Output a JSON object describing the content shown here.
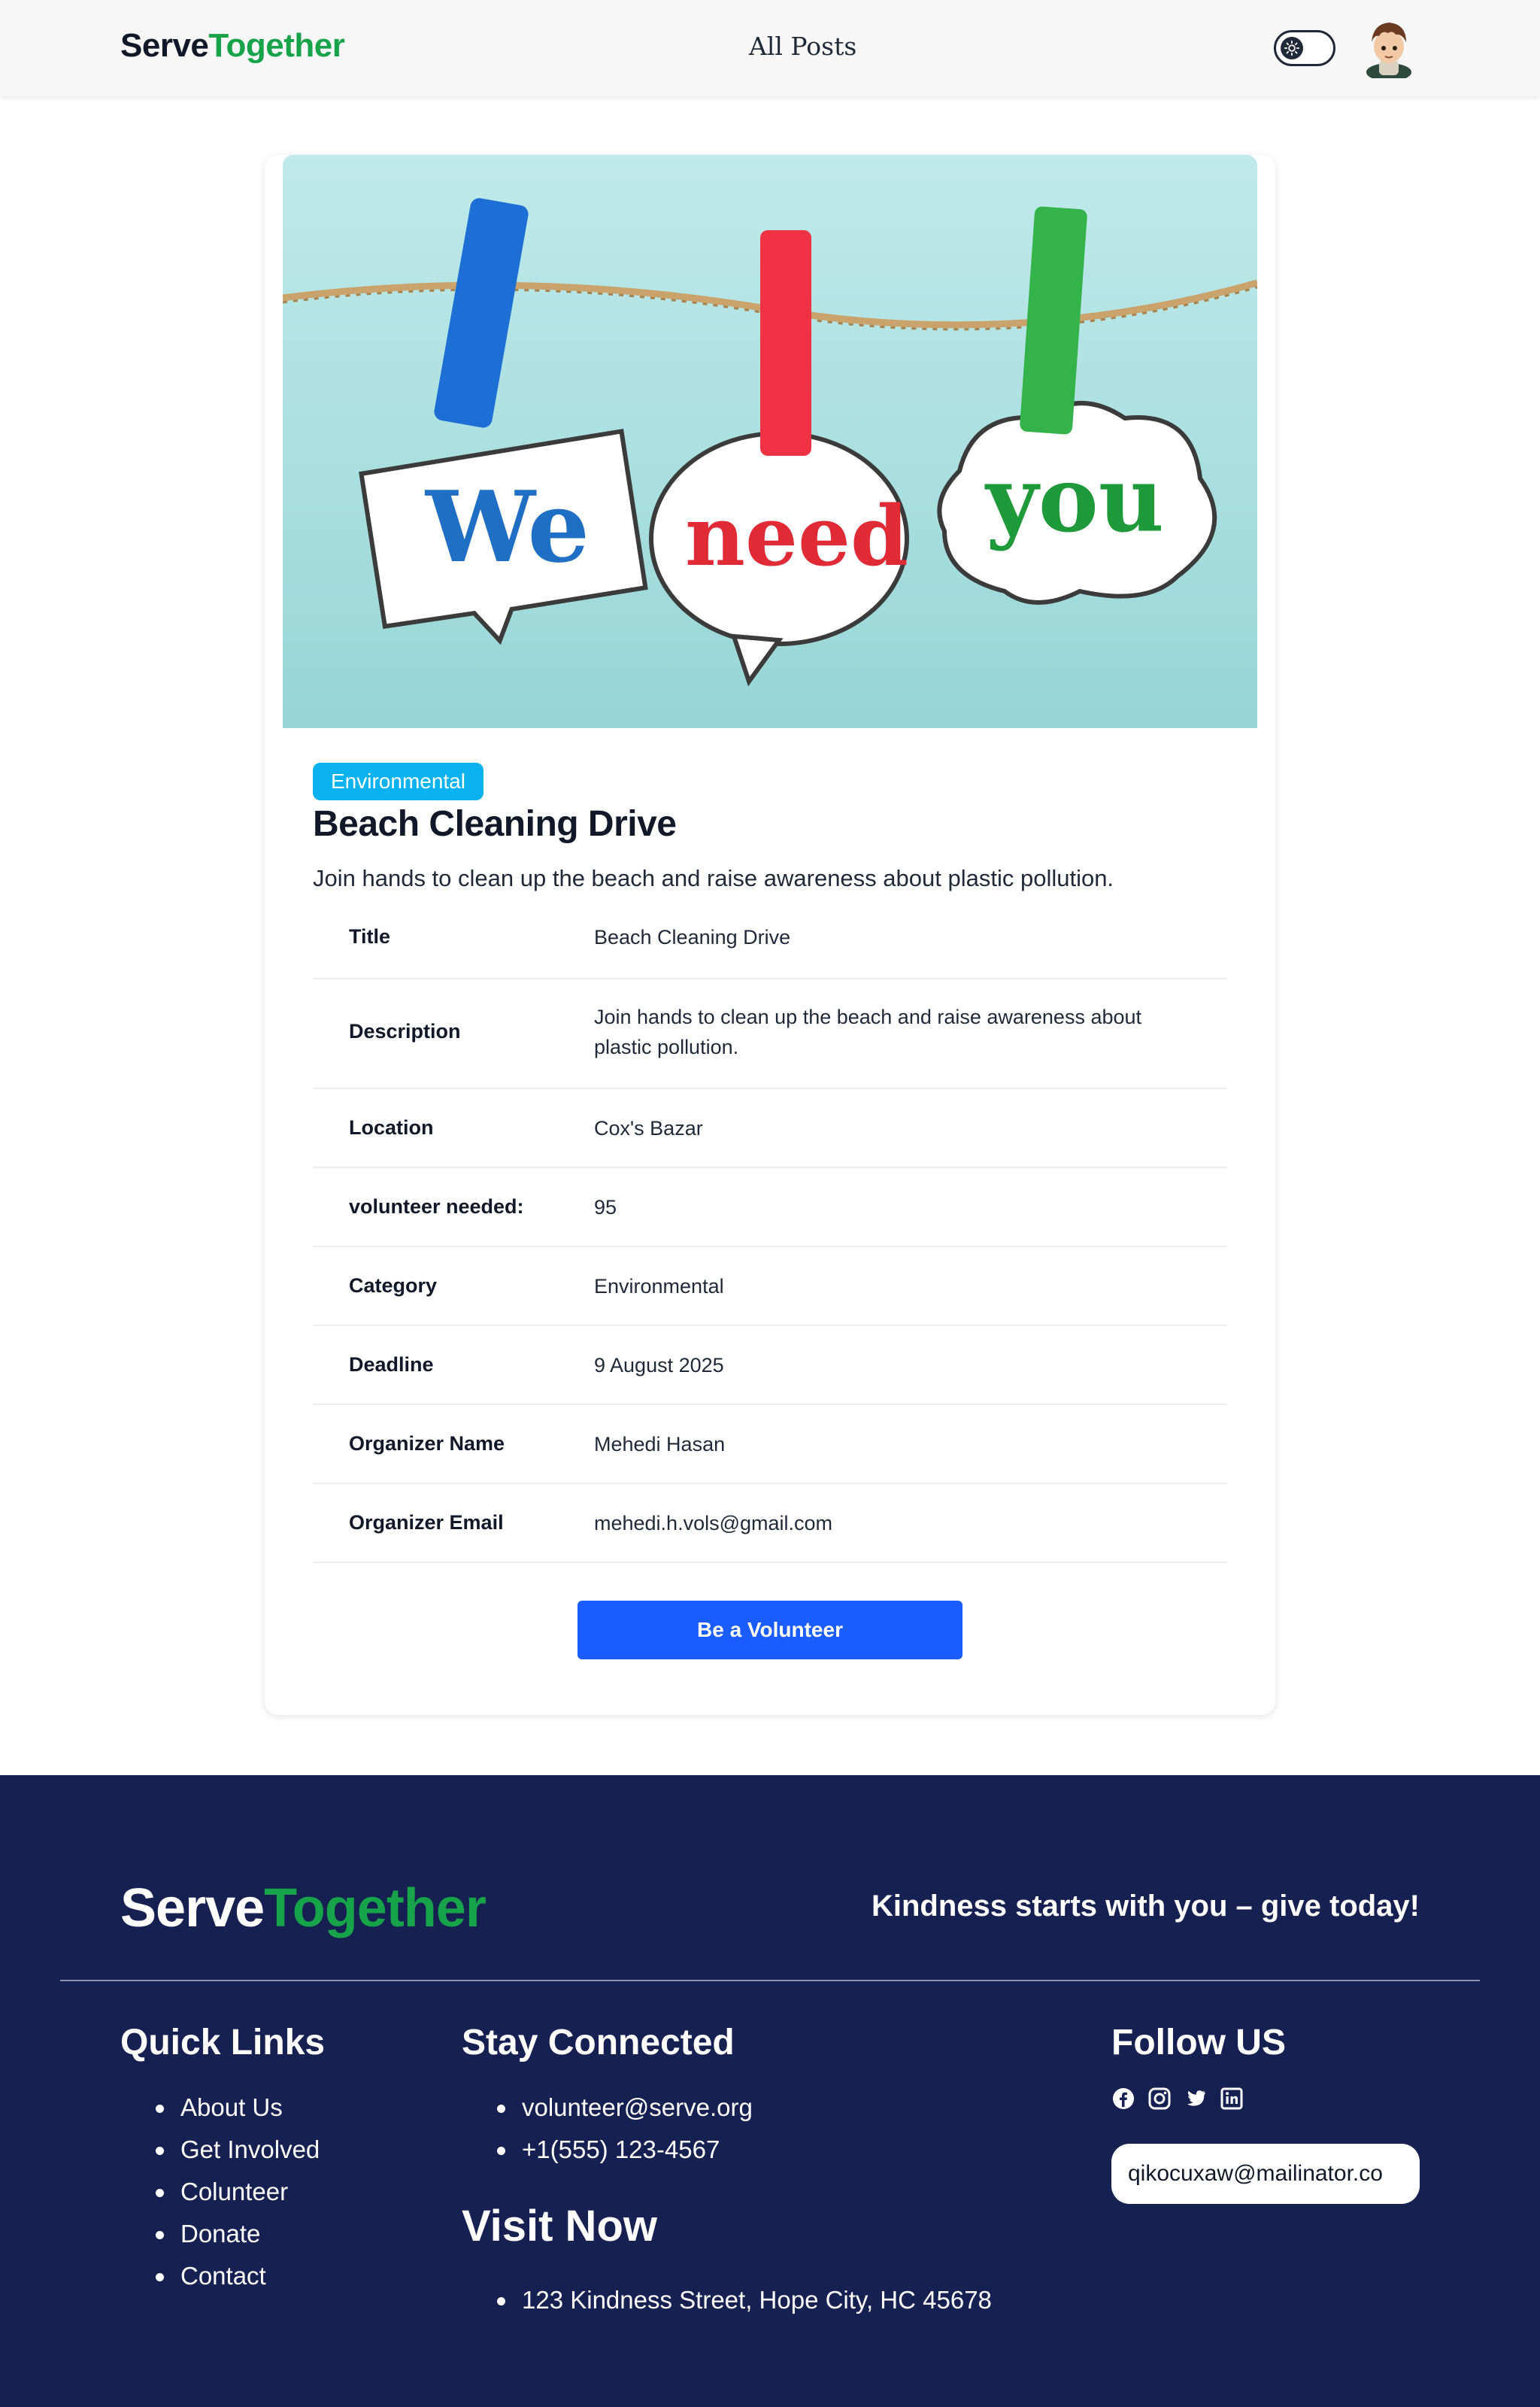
{
  "navbar": {
    "logo_part1": "Serve",
    "logo_part2": "Together",
    "all_posts": "All Posts",
    "theme_toggle_icon": "sun-icon",
    "avatar_icon": "user-avatar"
  },
  "post": {
    "image_text": [
      "We",
      "need",
      "you"
    ],
    "category_badge": "Environmental",
    "title": "Beach Cleaning Drive",
    "description": "Join hands to clean up the beach and raise awareness about plastic pollution.",
    "details": [
      {
        "label": "Title",
        "value": "Beach Cleaning Drive"
      },
      {
        "label": "Description",
        "value": "Join hands to clean up the beach and raise awareness about plastic pollution."
      },
      {
        "label": "Location",
        "value": "Cox's Bazar"
      },
      {
        "label": "volunteer needed:",
        "value": "95"
      },
      {
        "label": "Category",
        "value": "Environmental"
      },
      {
        "label": "Deadline",
        "value": "9 August 2025"
      },
      {
        "label": "Organizer Name",
        "value": "Mehedi Hasan"
      },
      {
        "label": "Organizer Email",
        "value": "mehedi.h.vols@gmail.com"
      }
    ],
    "volunteer_button": "Be a Volunteer"
  },
  "footer": {
    "logo_part1": "Serve",
    "logo_part2": "Together",
    "tagline": "Kindness starts with you – give today!",
    "quick_links_heading": "Quick Links",
    "quick_links": [
      "About Us",
      "Get Involved",
      "Colunteer",
      "Donate",
      "Contact"
    ],
    "stay_connected_heading": "Stay Connected",
    "contacts": [
      "volunteer@serve.org",
      "+1(555) 123-4567"
    ],
    "visit_heading": "Visit Now",
    "address": "123 Kindness Street, Hope City, HC 45678",
    "follow_heading": "Follow US",
    "social_icons": [
      "facebook-icon",
      "instagram-icon",
      "twitter-icon",
      "linkedin-icon"
    ],
    "email_value": "qikocuxaw@mailinator.co"
  },
  "colors": {
    "brand_green": "#16a34a",
    "footer_bg": "#172151",
    "button_blue": "#1b5cff",
    "badge_cyan": "#0ab3f0"
  }
}
